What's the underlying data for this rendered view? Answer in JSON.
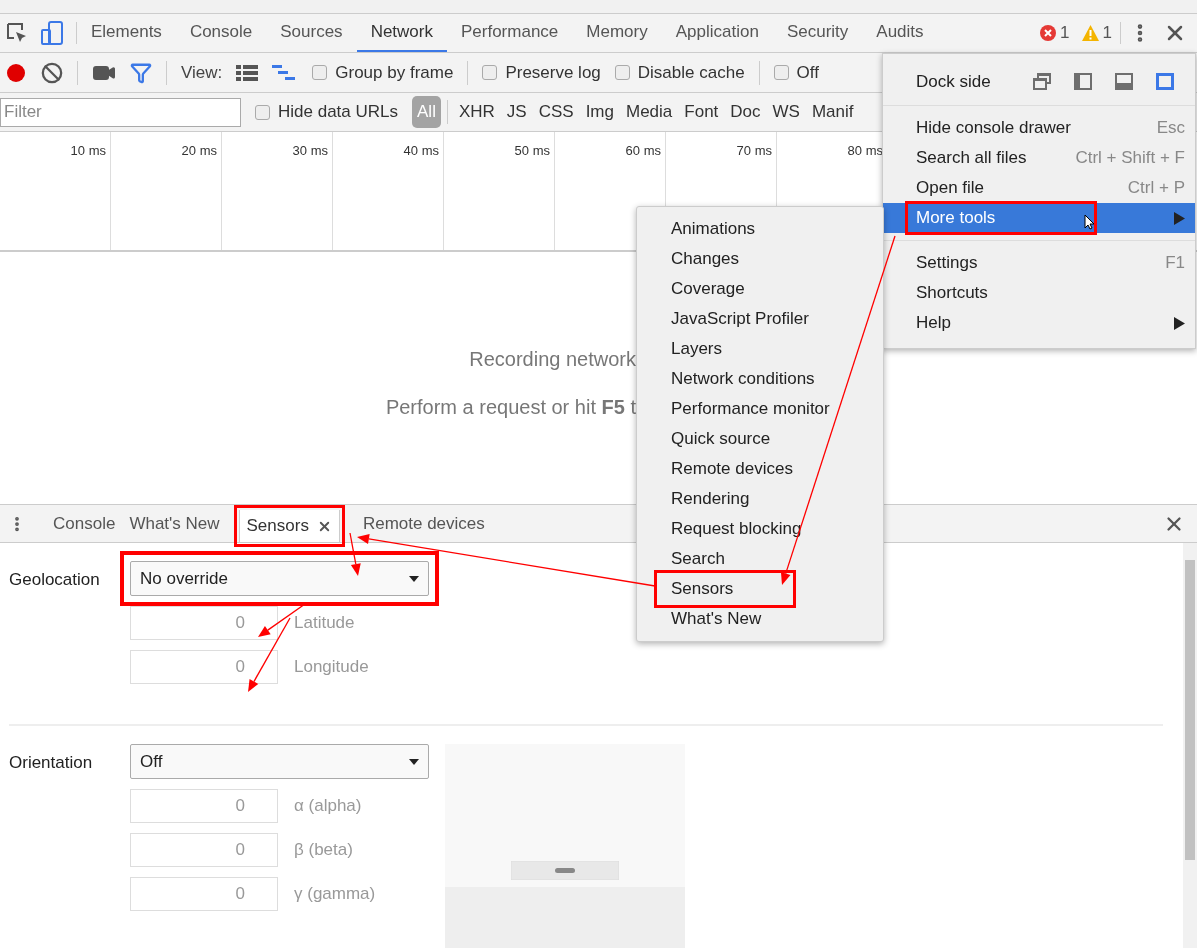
{
  "devtools_tabs": [
    {
      "label": "Elements",
      "selected": false
    },
    {
      "label": "Console",
      "selected": false
    },
    {
      "label": "Sources",
      "selected": false
    },
    {
      "label": "Network",
      "selected": true
    },
    {
      "label": "Performance",
      "selected": false
    },
    {
      "label": "Memory",
      "selected": false
    },
    {
      "label": "Application",
      "selected": false
    },
    {
      "label": "Security",
      "selected": false
    },
    {
      "label": "Audits",
      "selected": false
    }
  ],
  "issues": {
    "errors": "1",
    "warnings": "1"
  },
  "toolbar": {
    "recording": true,
    "view_label": "View:",
    "checkboxes": [
      {
        "label": "Group by frame",
        "checked": false
      },
      {
        "label": "Preserve log",
        "checked": false
      },
      {
        "label": "Disable cache",
        "checked": false
      },
      {
        "label": "Off",
        "checked": false
      }
    ]
  },
  "filter": {
    "placeholder": "Filter",
    "hide_data_urls": {
      "label": "Hide data URLs",
      "checked": false
    },
    "types": [
      {
        "label": "All",
        "selected": true
      },
      {
        "label": "XHR",
        "selected": false
      },
      {
        "label": "JS",
        "selected": false
      },
      {
        "label": "CSS",
        "selected": false
      },
      {
        "label": "Img",
        "selected": false
      },
      {
        "label": "Media",
        "selected": false
      },
      {
        "label": "Font",
        "selected": false
      },
      {
        "label": "Doc",
        "selected": false
      },
      {
        "label": "WS",
        "selected": false
      },
      {
        "label": "Manif",
        "selected": false
      }
    ]
  },
  "timeline": {
    "ticks": [
      "10 ms",
      "20 ms",
      "30 ms",
      "40 ms",
      "50 ms",
      "60 ms",
      "70 ms",
      "80 ms"
    ]
  },
  "empty_state": {
    "title": "Recording network",
    "hint": "Perform a request or hit **F5** t"
  },
  "drawer": {
    "tabs": [
      {
        "label": "Console",
        "selected": false,
        "closable": false,
        "annotated": false
      },
      {
        "label": "What's New",
        "selected": false,
        "closable": false,
        "annotated": false
      },
      {
        "label": "Sensors",
        "selected": true,
        "closable": true,
        "annotated": true
      },
      {
        "label": "Remote devices",
        "selected": false,
        "closable": false
      }
    ]
  },
  "sensors": {
    "sections": [
      {
        "label": "Geolocation",
        "value": "No override",
        "annotated": true,
        "fields": [
          {
            "placeholder": "0",
            "label": "Latitude"
          },
          {
            "placeholder": "0",
            "label": "Longitude"
          }
        ]
      },
      {
        "label": "Orientation",
        "value": "Off",
        "preview": true,
        "fields": [
          {
            "placeholder": "0",
            "label": "α (alpha)"
          },
          {
            "placeholder": "0",
            "label": "β (beta)"
          },
          {
            "placeholder": "0",
            "label": "γ (gamma)"
          }
        ]
      }
    ]
  },
  "main_menu": {
    "dock_side_label": "Dock side",
    "dock_options": [
      {
        "kind": "undock",
        "selected": false
      },
      {
        "kind": "left",
        "selected": false
      },
      {
        "kind": "bottom",
        "selected": false
      },
      {
        "kind": "right",
        "selected": true
      }
    ],
    "groups": [
      [
        {
          "label": "Hide console drawer",
          "shortcut": "Esc",
          "submenu": false,
          "selected": false,
          "annotated": false
        },
        {
          "label": "Search all files",
          "shortcut": "Ctrl + Shift + F",
          "submenu": false,
          "selected": false,
          "annotated": false
        },
        {
          "label": "Open file",
          "shortcut": "Ctrl + P",
          "submenu": false,
          "selected": false,
          "annotated": false
        },
        {
          "label": "More tools",
          "submenu": true,
          "selected": true,
          "annotated": true
        }
      ],
      [
        {
          "label": "Settings",
          "shortcut": "F1",
          "submenu": false,
          "selected": false,
          "annotated": false
        },
        {
          "label": "Shortcuts",
          "submenu": false,
          "selected": false,
          "annotated": false
        },
        {
          "label": "Help",
          "submenu": true,
          "selected": false,
          "annotated": false
        }
      ]
    ]
  },
  "more_tools_menu": {
    "items": [
      {
        "label": "Animations",
        "annotated": false
      },
      {
        "label": "Changes",
        "annotated": false
      },
      {
        "label": "Coverage",
        "annotated": false
      },
      {
        "label": "JavaScript Profiler",
        "annotated": false
      },
      {
        "label": "Layers",
        "annotated": false
      },
      {
        "label": "Network conditions",
        "annotated": false
      },
      {
        "label": "Performance monitor",
        "annotated": false
      },
      {
        "label": "Quick source",
        "annotated": false
      },
      {
        "label": "Remote devices",
        "annotated": false
      },
      {
        "label": "Rendering",
        "annotated": false
      },
      {
        "label": "Request blocking",
        "annotated": false
      },
      {
        "label": "Search",
        "annotated": false
      },
      {
        "label": "Sensors",
        "annotated": true
      },
      {
        "label": "What's New",
        "annotated": false
      }
    ]
  }
}
